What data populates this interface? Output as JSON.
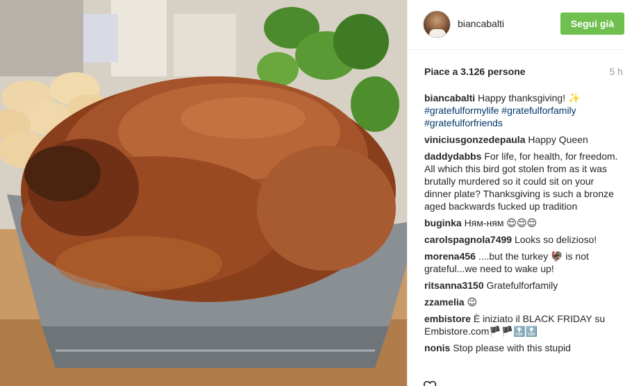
{
  "post": {
    "username": "biancabalti",
    "follow_label": "Segui già",
    "likes": "Piace a 3.126 persone",
    "time": "5 h"
  },
  "comments": [
    {
      "user": "biancabalti",
      "text": "Happy thanksgiving! ✨",
      "tags": [
        "#gratefulformylife",
        "#gratefulforfamily",
        "#gratefulforfriends"
      ]
    },
    {
      "user": "viniciusgonzedepaula",
      "text": "Happy Queen"
    },
    {
      "user": "daddydabbs",
      "text": "For life, for health, for freedom. All which this bird got stolen from as it was brutally murdered so it could sit on your dinner plate? Thanksgiving is such a bronze aged backwards fucked up tradition"
    },
    {
      "user": "buginka",
      "text": "Ням-ням 😌😌😌"
    },
    {
      "user": "carolspagnola7499",
      "text": "Looks so delizioso!"
    },
    {
      "user": "morena456",
      "text": "....but the turkey 🦃 is not grateful...we need to wake up!"
    },
    {
      "user": "ritsanna3150",
      "text": "Gratefulforfamily"
    },
    {
      "user": "zzamelia",
      "text": "😉"
    },
    {
      "user": "embistore",
      "text": "È iniziato il BLACK FRIDAY su Embistore.com🏴🏴🔝🔝"
    },
    {
      "user": "nonis",
      "text": "Stop please with this stupid"
    }
  ],
  "colors": {
    "follow_button": "#70c050",
    "hashtag": "#003569",
    "muted": "#999999"
  },
  "icons": [
    "heart-icon"
  ]
}
